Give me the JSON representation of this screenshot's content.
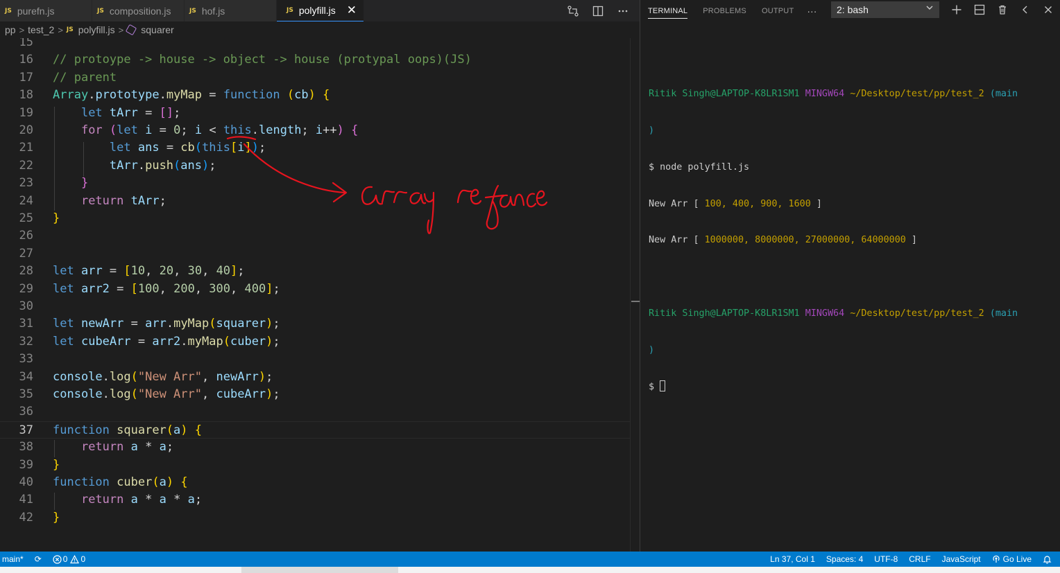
{
  "editor": {
    "tabs": [
      {
        "label": "purefn.js",
        "badge": "JS",
        "active": false
      },
      {
        "label": "composition.js",
        "badge": "JS",
        "active": false
      },
      {
        "label": "hof.js",
        "badge": "JS",
        "active": false
      },
      {
        "label": "polyfill.js",
        "badge": "JS",
        "active": true
      }
    ],
    "close_glyph": "✕",
    "breadcrumbs": [
      "pp",
      "test_2",
      "polyfill.js",
      "squarer"
    ],
    "breadcrumb_badge": "JS",
    "breadcrumb_sep": ">",
    "current_line": 37,
    "lines": [
      {
        "n": "15",
        "tokens": []
      },
      {
        "n": "16",
        "tokens": [
          {
            "c": "com",
            "t": "// protoype -> house -> object -> house (protypal oops)(JS)"
          }
        ]
      },
      {
        "n": "17",
        "tokens": [
          {
            "c": "com",
            "t": "// parent"
          }
        ]
      },
      {
        "n": "18",
        "tokens": [
          {
            "c": "cls",
            "t": "Array"
          },
          {
            "c": "pun",
            "t": "."
          },
          {
            "c": "var",
            "t": "prototype"
          },
          {
            "c": "pun",
            "t": "."
          },
          {
            "c": "fn",
            "t": "myMap"
          },
          {
            "c": "pun",
            "t": " = "
          },
          {
            "c": "kw",
            "t": "function"
          },
          {
            "c": "pun",
            "t": " "
          },
          {
            "c": "b1",
            "t": "("
          },
          {
            "c": "var",
            "t": "cb"
          },
          {
            "c": "b1",
            "t": ")"
          },
          {
            "c": "pun",
            "t": " "
          },
          {
            "c": "b1",
            "t": "{"
          }
        ]
      },
      {
        "n": "19",
        "tokens": [
          {
            "c": "pun",
            "t": "    "
          },
          {
            "c": "kw",
            "t": "let"
          },
          {
            "c": "pun",
            "t": " "
          },
          {
            "c": "var",
            "t": "tArr"
          },
          {
            "c": "pun",
            "t": " = "
          },
          {
            "c": "b2",
            "t": "[]"
          },
          {
            "c": "pun",
            "t": ";"
          }
        ]
      },
      {
        "n": "20",
        "tokens": [
          {
            "c": "pun",
            "t": "    "
          },
          {
            "c": "ctl",
            "t": "for"
          },
          {
            "c": "pun",
            "t": " "
          },
          {
            "c": "b2",
            "t": "("
          },
          {
            "c": "kw",
            "t": "let"
          },
          {
            "c": "pun",
            "t": " "
          },
          {
            "c": "var",
            "t": "i"
          },
          {
            "c": "pun",
            "t": " = "
          },
          {
            "c": "num",
            "t": "0"
          },
          {
            "c": "pun",
            "t": "; "
          },
          {
            "c": "var",
            "t": "i"
          },
          {
            "c": "pun",
            "t": " < "
          },
          {
            "c": "kw",
            "t": "this"
          },
          {
            "c": "pun",
            "t": "."
          },
          {
            "c": "var",
            "t": "length"
          },
          {
            "c": "pun",
            "t": "; "
          },
          {
            "c": "var",
            "t": "i"
          },
          {
            "c": "pun",
            "t": "++"
          },
          {
            "c": "b2",
            "t": ")"
          },
          {
            "c": "pun",
            "t": " "
          },
          {
            "c": "b2",
            "t": "{"
          }
        ]
      },
      {
        "n": "21",
        "tokens": [
          {
            "c": "pun",
            "t": "        "
          },
          {
            "c": "kw",
            "t": "let"
          },
          {
            "c": "pun",
            "t": " "
          },
          {
            "c": "var",
            "t": "ans"
          },
          {
            "c": "pun",
            "t": " = "
          },
          {
            "c": "fn",
            "t": "cb"
          },
          {
            "c": "b3",
            "t": "("
          },
          {
            "c": "kw",
            "t": "this"
          },
          {
            "c": "b1",
            "t": "["
          },
          {
            "c": "var",
            "t": "i"
          },
          {
            "c": "b1",
            "t": "]"
          },
          {
            "c": "b3",
            "t": ")"
          },
          {
            "c": "pun",
            "t": ";"
          }
        ]
      },
      {
        "n": "22",
        "tokens": [
          {
            "c": "pun",
            "t": "        "
          },
          {
            "c": "var",
            "t": "tArr"
          },
          {
            "c": "pun",
            "t": "."
          },
          {
            "c": "fn",
            "t": "push"
          },
          {
            "c": "b3",
            "t": "("
          },
          {
            "c": "var",
            "t": "ans"
          },
          {
            "c": "b3",
            "t": ")"
          },
          {
            "c": "pun",
            "t": ";"
          }
        ]
      },
      {
        "n": "23",
        "tokens": [
          {
            "c": "pun",
            "t": "    "
          },
          {
            "c": "b2",
            "t": "}"
          }
        ]
      },
      {
        "n": "24",
        "tokens": [
          {
            "c": "pun",
            "t": "    "
          },
          {
            "c": "ctl",
            "t": "return"
          },
          {
            "c": "pun",
            "t": " "
          },
          {
            "c": "var",
            "t": "tArr"
          },
          {
            "c": "pun",
            "t": ";"
          }
        ]
      },
      {
        "n": "25",
        "tokens": [
          {
            "c": "b1",
            "t": "}"
          }
        ]
      },
      {
        "n": "26",
        "tokens": []
      },
      {
        "n": "27",
        "tokens": []
      },
      {
        "n": "28",
        "tokens": [
          {
            "c": "kw",
            "t": "let"
          },
          {
            "c": "pun",
            "t": " "
          },
          {
            "c": "var",
            "t": "arr"
          },
          {
            "c": "pun",
            "t": " = "
          },
          {
            "c": "b1",
            "t": "["
          },
          {
            "c": "num",
            "t": "10"
          },
          {
            "c": "pun",
            "t": ", "
          },
          {
            "c": "num",
            "t": "20"
          },
          {
            "c": "pun",
            "t": ", "
          },
          {
            "c": "num",
            "t": "30"
          },
          {
            "c": "pun",
            "t": ", "
          },
          {
            "c": "num",
            "t": "40"
          },
          {
            "c": "b1",
            "t": "]"
          },
          {
            "c": "pun",
            "t": ";"
          }
        ]
      },
      {
        "n": "29",
        "tokens": [
          {
            "c": "kw",
            "t": "let"
          },
          {
            "c": "pun",
            "t": " "
          },
          {
            "c": "var",
            "t": "arr2"
          },
          {
            "c": "pun",
            "t": " = "
          },
          {
            "c": "b1",
            "t": "["
          },
          {
            "c": "num",
            "t": "100"
          },
          {
            "c": "pun",
            "t": ", "
          },
          {
            "c": "num",
            "t": "200"
          },
          {
            "c": "pun",
            "t": ", "
          },
          {
            "c": "num",
            "t": "300"
          },
          {
            "c": "pun",
            "t": ", "
          },
          {
            "c": "num",
            "t": "400"
          },
          {
            "c": "b1",
            "t": "]"
          },
          {
            "c": "pun",
            "t": ";"
          }
        ]
      },
      {
        "n": "30",
        "tokens": []
      },
      {
        "n": "31",
        "tokens": [
          {
            "c": "kw",
            "t": "let"
          },
          {
            "c": "pun",
            "t": " "
          },
          {
            "c": "var",
            "t": "newArr"
          },
          {
            "c": "pun",
            "t": " = "
          },
          {
            "c": "var",
            "t": "arr"
          },
          {
            "c": "pun",
            "t": "."
          },
          {
            "c": "fn",
            "t": "myMap"
          },
          {
            "c": "b1",
            "t": "("
          },
          {
            "c": "var",
            "t": "squarer"
          },
          {
            "c": "b1",
            "t": ")"
          },
          {
            "c": "pun",
            "t": ";"
          }
        ]
      },
      {
        "n": "32",
        "tokens": [
          {
            "c": "kw",
            "t": "let"
          },
          {
            "c": "pun",
            "t": " "
          },
          {
            "c": "var",
            "t": "cubeArr"
          },
          {
            "c": "pun",
            "t": " = "
          },
          {
            "c": "var",
            "t": "arr2"
          },
          {
            "c": "pun",
            "t": "."
          },
          {
            "c": "fn",
            "t": "myMap"
          },
          {
            "c": "b1",
            "t": "("
          },
          {
            "c": "var",
            "t": "cuber"
          },
          {
            "c": "b1",
            "t": ")"
          },
          {
            "c": "pun",
            "t": ";"
          }
        ]
      },
      {
        "n": "33",
        "tokens": []
      },
      {
        "n": "34",
        "tokens": [
          {
            "c": "var",
            "t": "console"
          },
          {
            "c": "pun",
            "t": "."
          },
          {
            "c": "fn",
            "t": "log"
          },
          {
            "c": "b1",
            "t": "("
          },
          {
            "c": "str",
            "t": "\"New Arr\""
          },
          {
            "c": "pun",
            "t": ", "
          },
          {
            "c": "var",
            "t": "newArr"
          },
          {
            "c": "b1",
            "t": ")"
          },
          {
            "c": "pun",
            "t": ";"
          }
        ]
      },
      {
        "n": "35",
        "tokens": [
          {
            "c": "var",
            "t": "console"
          },
          {
            "c": "pun",
            "t": "."
          },
          {
            "c": "fn",
            "t": "log"
          },
          {
            "c": "b1",
            "t": "("
          },
          {
            "c": "str",
            "t": "\"New Arr\""
          },
          {
            "c": "pun",
            "t": ", "
          },
          {
            "c": "var",
            "t": "cubeArr"
          },
          {
            "c": "b1",
            "t": ")"
          },
          {
            "c": "pun",
            "t": ";"
          }
        ]
      },
      {
        "n": "36",
        "tokens": []
      },
      {
        "n": "37",
        "tokens": [
          {
            "c": "kw",
            "t": "function"
          },
          {
            "c": "pun",
            "t": " "
          },
          {
            "c": "fn",
            "t": "squarer"
          },
          {
            "c": "b1",
            "t": "("
          },
          {
            "c": "var",
            "t": "a"
          },
          {
            "c": "b1",
            "t": ")"
          },
          {
            "c": "pun",
            "t": " "
          },
          {
            "c": "b1",
            "t": "{"
          }
        ]
      },
      {
        "n": "38",
        "tokens": [
          {
            "c": "pun",
            "t": "    "
          },
          {
            "c": "ctl",
            "t": "return"
          },
          {
            "c": "pun",
            "t": " "
          },
          {
            "c": "var",
            "t": "a"
          },
          {
            "c": "pun",
            "t": " * "
          },
          {
            "c": "var",
            "t": "a"
          },
          {
            "c": "pun",
            "t": ";"
          }
        ]
      },
      {
        "n": "39",
        "tokens": [
          {
            "c": "b1",
            "t": "}"
          }
        ]
      },
      {
        "n": "40",
        "tokens": [
          {
            "c": "kw",
            "t": "function"
          },
          {
            "c": "pun",
            "t": " "
          },
          {
            "c": "fn",
            "t": "cuber"
          },
          {
            "c": "b1",
            "t": "("
          },
          {
            "c": "var",
            "t": "a"
          },
          {
            "c": "b1",
            "t": ")"
          },
          {
            "c": "pun",
            "t": " "
          },
          {
            "c": "b1",
            "t": "{"
          }
        ]
      },
      {
        "n": "41",
        "tokens": [
          {
            "c": "pun",
            "t": "    "
          },
          {
            "c": "ctl",
            "t": "return"
          },
          {
            "c": "pun",
            "t": " "
          },
          {
            "c": "var",
            "t": "a"
          },
          {
            "c": "pun",
            "t": " * "
          },
          {
            "c": "var",
            "t": "a"
          },
          {
            "c": "pun",
            "t": " * "
          },
          {
            "c": "var",
            "t": "a"
          },
          {
            "c": "pun",
            "t": ";"
          }
        ]
      },
      {
        "n": "42",
        "tokens": [
          {
            "c": "b1",
            "t": "}"
          }
        ]
      }
    ],
    "handwritten_note": "Array refance",
    "note_color": "#e8141e"
  },
  "panel": {
    "tabs": [
      "TERMINAL",
      "PROBLEMS",
      "OUTPUT"
    ],
    "active_tab": "TERMINAL",
    "more_glyph": "···",
    "terminal_select": "2: bash",
    "actions": [
      {
        "name": "new-terminal-icon",
        "glyph": "+"
      },
      {
        "name": "split-terminal-icon",
        "glyph": "⊟"
      },
      {
        "name": "trash-icon",
        "glyph": "🗑"
      },
      {
        "name": "chevron-left-icon",
        "glyph": "‹"
      },
      {
        "name": "close-panel-icon",
        "glyph": "✕"
      }
    ]
  },
  "terminal": {
    "prompt_user": "Ritik Singh@LAPTOP-K8LR1SM1",
    "prompt_env": "MINGW64",
    "prompt_path": "~/Desktop/test/pp/test_2",
    "prompt_branch": "(main",
    "prompt_branch_close": ")",
    "command": "$ node polyfill.js",
    "output_1_label": "New Arr [ ",
    "output_1_values": "100, 400, 900, 1600",
    "output_1_end": " ]",
    "output_2_label": "New Arr [ ",
    "output_2_values": "1000000, 8000000, 27000000, 64000000",
    "output_2_end": " ]",
    "prompt_symbol": "$ "
  },
  "statusbar": {
    "branch": "main*",
    "sync_glyph": "⟳",
    "errors": "0",
    "warnings": "0",
    "position": "Ln 37, Col 1",
    "spaces": "Spaces: 4",
    "encoding": "UTF-8",
    "eol": "CRLF",
    "language": "JavaScript",
    "go_live": "Go Live",
    "bell_glyph": "🔔"
  },
  "colors": {
    "status_bar": "#007acc",
    "editor_bg": "#1e1e1e",
    "annotation": "#e8141e"
  }
}
